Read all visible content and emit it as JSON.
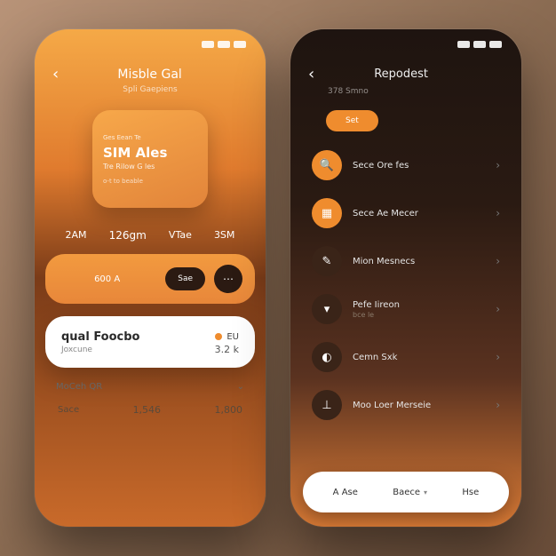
{
  "colors": {
    "accent": "#ef8c2e",
    "dark": "#2b1a12"
  },
  "left": {
    "status_time": "",
    "header": {
      "title": "Misble Gal",
      "subtitle": "Spli Gaepiens"
    },
    "featured": {
      "line1": "Ges Eean Te",
      "line2": "SIM Ales",
      "line3": "Tre Rilow G les",
      "line4": "o-t to beable"
    },
    "times": {
      "a": "2AM",
      "b": "126gm",
      "c": "VTae",
      "d": "3SM"
    },
    "pill": {
      "label": "600 A",
      "button": "Sae"
    },
    "card": {
      "title": "qual Foocbo",
      "subtitle": "Joxcune",
      "badge": "EU",
      "value": "3.2 k"
    },
    "qr": {
      "label": "MoCeh QR",
      "right": "⌄"
    },
    "bottom": {
      "label": "Sace",
      "val1": "1,546",
      "val2": "1,800"
    }
  },
  "right": {
    "header": {
      "title": "Repodest",
      "subtitle": "378 Smno"
    },
    "chip": "Set",
    "items": [
      {
        "icon": "🔍",
        "label": "Sece Ore fes",
        "sub": "",
        "style": "accent"
      },
      {
        "icon": "▦",
        "label": "Sece Ae Mecer",
        "sub": "",
        "style": "accent"
      },
      {
        "icon": "✎",
        "label": "Mion Mesnecs",
        "sub": "",
        "style": "dark"
      },
      {
        "icon": "▾",
        "label": "Pefe Iireon",
        "sub": "bce le",
        "style": "dark"
      },
      {
        "icon": "◐",
        "label": "Cemn Sxk",
        "sub": "",
        "style": "dark"
      },
      {
        "icon": "⊥",
        "label": "Moo Loer Merseie",
        "sub": "",
        "style": "dark"
      }
    ],
    "bottombar": {
      "tab1": "A Ase",
      "tab2": "Baece",
      "tab3": "Hse"
    }
  }
}
